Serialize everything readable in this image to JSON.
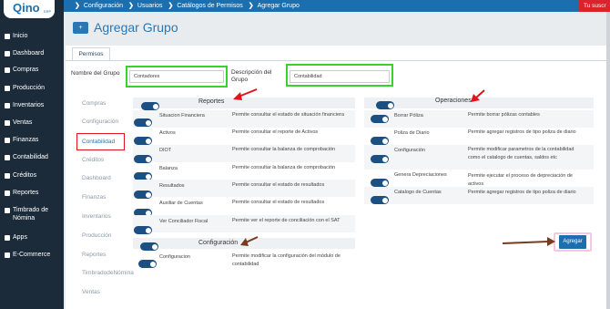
{
  "logo": {
    "text": "Qino",
    "sub": "ERP"
  },
  "sidebar": {
    "items": [
      {
        "label": "Inicio",
        "icon": "home-icon"
      },
      {
        "label": "Dashboard",
        "icon": "dashboard-icon"
      },
      {
        "label": "Compras",
        "icon": "cart-icon"
      },
      {
        "label": "Producción",
        "icon": "factory-icon"
      },
      {
        "label": "Inventarios",
        "icon": "truck-icon"
      },
      {
        "label": "Ventas",
        "icon": "sales-icon"
      },
      {
        "label": "Finanzas",
        "icon": "dollar-icon"
      },
      {
        "label": "Contabilidad",
        "icon": "book-icon"
      },
      {
        "label": "Créditos",
        "icon": "credit-icon"
      },
      {
        "label": "Reportes",
        "icon": "chart-icon"
      },
      {
        "label": "Timbrado de",
        "label2": "Nómina",
        "icon": "stamp-icon"
      },
      {
        "label": "Apps",
        "icon": "apps-icon"
      },
      {
        "label": "E-Commerce",
        "icon": "ecommerce-icon"
      }
    ]
  },
  "topbar": {
    "breadcrumbs": [
      "Configuración",
      "Usuarios",
      "Catálogos de Permisos",
      "Agregar Grupo"
    ],
    "badge": "Tu suscr"
  },
  "page": {
    "title": "Agregar Grupo"
  },
  "tabs": [
    {
      "label": "Permisos"
    }
  ],
  "form": {
    "group_name_label": "Nombre del Grupo",
    "group_name_value": "Contadores",
    "description_label": "Descripción del Grupo",
    "description_value": "Contabilidad"
  },
  "categories": [
    "Compras",
    "Configuración",
    "Contabilidad",
    "Créditos",
    "Dashboard",
    "Finanzas",
    "Inventarios",
    "Producción",
    "Reportes",
    "TimbradodeNómina",
    "Ventas"
  ],
  "active_category": "Contabilidad",
  "sections": {
    "reportes": {
      "title": "Reportes",
      "rows": [
        {
          "name": "Situacion Financiera",
          "desc": "Permite consultar el estado de situación financiera"
        },
        {
          "name": "Activos",
          "desc": "Permite consultar el reporte de Activos"
        },
        {
          "name": "DIOT",
          "desc": "Permite consultar la balanza de comprobación"
        },
        {
          "name": "Balanza",
          "desc": "Permite consultar la balanza de comprobación"
        },
        {
          "name": "Resultados",
          "desc": "Permite consultar el estado de resultados"
        },
        {
          "name": "Auxiliar de Cuentas",
          "desc": "Permite consultar el estado de resultados"
        },
        {
          "name": "Ver Conciliador Fiscal",
          "desc": "Permite ver el reporte de conciliación con el SAT"
        }
      ]
    },
    "configuracion": {
      "title": "Configuración",
      "rows": [
        {
          "name": "Configuracion",
          "desc": "Permite modificar la configuración del módulo de contabilidad"
        }
      ]
    },
    "operaciones": {
      "title": "Operaciones",
      "rows": [
        {
          "name": "Borrar Póliza",
          "desc": "Permite borrar pólizas contables"
        },
        {
          "name": "Poliza de Diario",
          "desc": "Permite agregar registros de tipo poliza de diario"
        },
        {
          "name": "Configuración",
          "desc": "Permite modificar parametros de la contabilidad como el catalogo de cuentas, saldos etc"
        },
        {
          "name": "Genera Depreciaciones",
          "desc": "Permite ejecutar el proceso de depreciación de activos"
        },
        {
          "name": "Catalogo de Cuentas",
          "desc": "Permite agregar registros de tipo poliza de diario"
        }
      ]
    }
  },
  "actions": {
    "submit": "Agregar"
  },
  "colors": {
    "primary": "#1c6fae",
    "sidebar": "#1c2b3a",
    "highlight_green": "#39d12b",
    "highlight_red": "#e0141e",
    "arrow": "#e0141e",
    "arrow_brown": "#7a3a1e"
  }
}
